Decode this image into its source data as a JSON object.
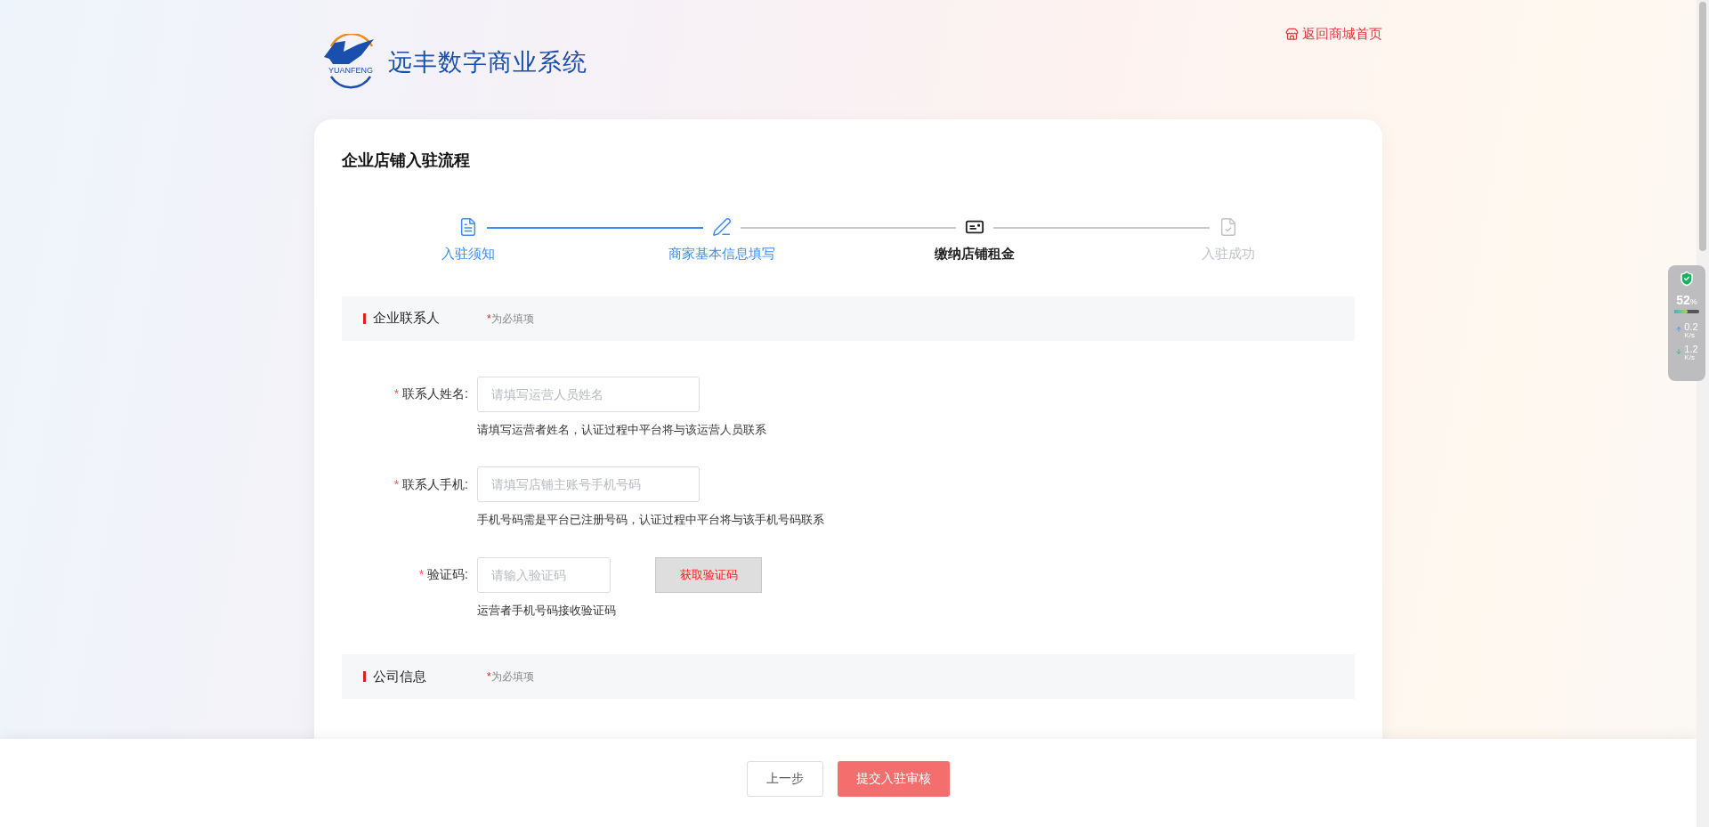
{
  "header": {
    "logo_badge": "YUANFENG",
    "logo_text": "远丰数字商业系统",
    "home_link": "返回商城首页"
  },
  "card": {
    "title": "企业店铺入驻流程",
    "steps": [
      {
        "label": "入驻须知",
        "completed": true,
        "selected": false
      },
      {
        "label": "商家基本信息填写",
        "completed": true,
        "selected": false
      },
      {
        "label": "缴纳店铺租金",
        "completed": false,
        "selected": true
      },
      {
        "label": "入驻成功",
        "completed": false,
        "selected": false
      }
    ],
    "sections": [
      {
        "title": "企业联系人",
        "required_mark": "*",
        "required_note": "为必填项",
        "fields": [
          {
            "kind": "text",
            "required_mark": "*",
            "label": "联系人姓名:",
            "placeholder": "请填写运营人员姓名",
            "hint": "请填写运营者姓名，认证过程中平台将与该运营人员联系"
          },
          {
            "kind": "text",
            "required_mark": "*",
            "label": "联系人手机:",
            "placeholder": "请填写店铺主账号手机号码",
            "hint": "手机号码需是平台已注册号码，认证过程中平台将与该手机号码联系"
          },
          {
            "kind": "code",
            "required_mark": "*",
            "label": "验证码:",
            "placeholder": "请输入验证码",
            "button": "获取验证码",
            "hint": "运营者手机号码接收验证码"
          }
        ]
      },
      {
        "title": "公司信息",
        "required_mark": "*",
        "required_note": "为必填项"
      }
    ]
  },
  "footer": {
    "buttons": [
      {
        "label": "上一步",
        "kind": "secondary"
      },
      {
        "label": "提交入驻审核",
        "kind": "primary"
      }
    ]
  },
  "monitor": {
    "percent": "52",
    "unit": "%",
    "level": 0.52,
    "upload": "0.2",
    "upload_unit": "K/s",
    "download": "1.2",
    "download_unit": "K/s"
  }
}
